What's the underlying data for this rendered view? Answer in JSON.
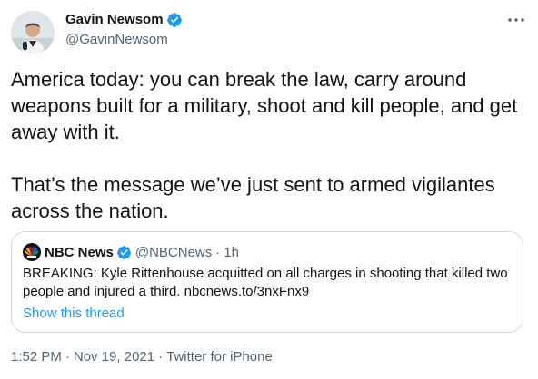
{
  "author": {
    "name": "Gavin Newsom",
    "handle": "@GavinNewsom"
  },
  "tweet": {
    "paragraphs": [
      "America today: you can break the law, carry around weapons built for a military, shoot and kill people, and get away with it.",
      "That’s the message we’ve just sent to armed vigilantes across the nation."
    ]
  },
  "quote": {
    "name": "NBC News",
    "handle": "@NBCNews",
    "separator": "·",
    "time": "1h",
    "text": "BREAKING: Kyle Rittenhouse acquitted on all charges in shooting that killed two people and injured a third. nbcnews.to/3nxFnx9",
    "link_label": "Show this thread"
  },
  "meta": {
    "time": "1:52 PM",
    "separator": "·",
    "date": "Nov 19, 2021",
    "source": "Twitter for iPhone"
  },
  "icons": {
    "avatar": "user-avatar-icon",
    "verified": "verified-badge-icon",
    "more": "more-options-icon",
    "nbc_logo": "nbc-peacock-icon"
  },
  "colors": {
    "accent": "#1d9bf0",
    "text": "#0f1419",
    "secondary": "#536471",
    "border": "#cfd9de"
  }
}
